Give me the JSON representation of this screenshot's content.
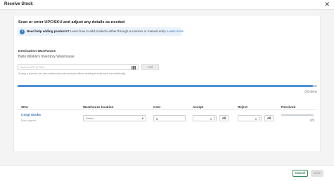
{
  "modal": {
    "title": "Receive Stock",
    "close_icon": "close-icon"
  },
  "instructions": "Scan or enter UPC/SKU and adjust any details as needed",
  "info_banner": {
    "icon": "info-icon",
    "bold": "Need help adding products?",
    "text": " Learn how to add products either through a scanner or manual entry. ",
    "link": "Learn more"
  },
  "destination": {
    "label": "Destination Warehouse",
    "value": "Bello Winkle's Inventory Warehouse"
  },
  "scan": {
    "placeholder": "Scan a UPC or SKU",
    "barcode_icon": "barcode-icon",
    "add_label": "Add",
    "hint": "If using a scanner, you can continuously scan products without needing to scale each one individually."
  },
  "progress": {
    "fraction": 0.985,
    "items_text": "0/0 items"
  },
  "table": {
    "headers": {
      "sku": "SKU",
      "warehouse_location": "Warehouse location",
      "cost": "Cost",
      "accept": "Accept",
      "reject": "Reject",
      "received": "Received"
    },
    "rows": [
      {
        "name": "Corgi Socks",
        "sku": "Misc-sogmee",
        "location_placeholder": "Select...",
        "cost": "$",
        "accept": "0",
        "accept_all": "All",
        "reject": "0",
        "reject_all": "All",
        "received": "0/2"
      }
    ]
  },
  "footer": {
    "cancel_label": "Cancel",
    "save_label": "Save"
  },
  "colors": {
    "accent": "#2f6fb6",
    "cancel_green": "#2e7d4f",
    "progress": "#4f8fd6"
  }
}
